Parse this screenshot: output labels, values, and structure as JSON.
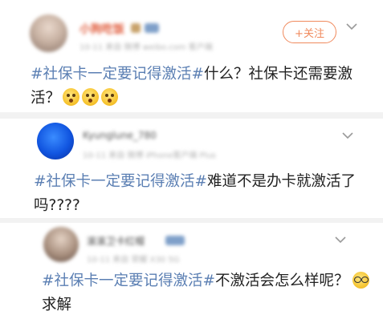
{
  "follow_button": {
    "icon": "plus-icon",
    "label": "+关注"
  },
  "posts": [
    {
      "username": "小狗吃饭",
      "meta": "10-11  来自 微博 weibo.com 客户端",
      "hashtag": "#社保卡一定要记得激活#",
      "text_line1": "什么？社保卡还需要激",
      "text_line2": "活？",
      "emoji_count": 3
    },
    {
      "username": "Kyunglune_780",
      "meta": "10-11  来自 微博 iPhone客户端 Plus",
      "hashtag": "#社保卡一定要记得激活#",
      "text_line1": "难道不是办卡就激活了",
      "text_line2": "吗????"
    },
    {
      "username": "滚滚卫卡红帽",
      "meta": "10-11  来自 荣耀 X30 5G",
      "hashtag": "#社保卡一定要记得激活#",
      "text_line1": "不激活会怎么样呢？",
      "text_line2": "求解"
    }
  ],
  "colors": {
    "hashtag": "#5b7fb3",
    "follow": "#f08a5d",
    "divider": "#f2f2f2"
  }
}
